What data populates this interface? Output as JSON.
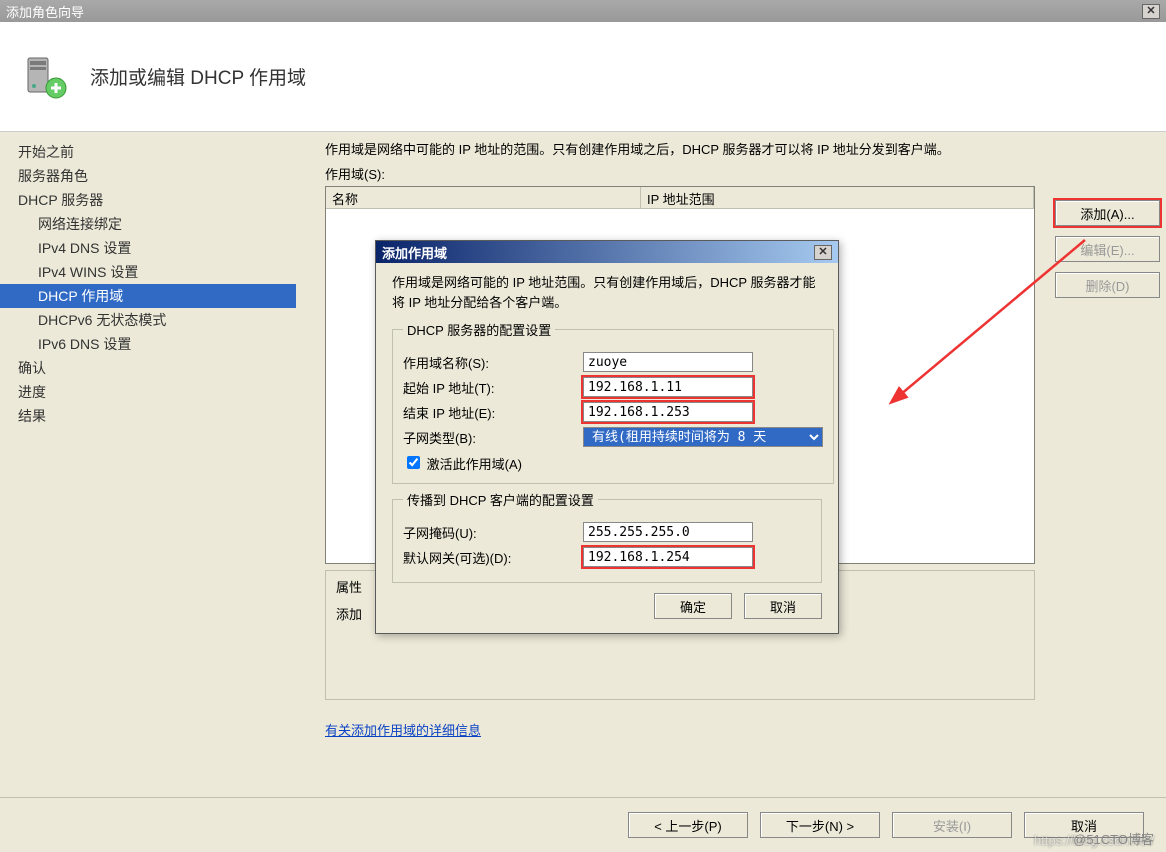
{
  "window": {
    "title": "添加角色向导"
  },
  "header": {
    "page_title": "添加或编辑 DHCP 作用域"
  },
  "sidebar": {
    "items": [
      {
        "label": "开始之前",
        "indent": false,
        "selected": false
      },
      {
        "label": "服务器角色",
        "indent": false,
        "selected": false
      },
      {
        "label": "DHCP 服务器",
        "indent": false,
        "selected": false
      },
      {
        "label": "网络连接绑定",
        "indent": true,
        "selected": false
      },
      {
        "label": "IPv4 DNS 设置",
        "indent": true,
        "selected": false
      },
      {
        "label": "IPv4 WINS 设置",
        "indent": true,
        "selected": false
      },
      {
        "label": "DHCP 作用域",
        "indent": true,
        "selected": true
      },
      {
        "label": "DHCPv6 无状态模式",
        "indent": true,
        "selected": false
      },
      {
        "label": "IPv6 DNS 设置",
        "indent": true,
        "selected": false
      },
      {
        "label": "确认",
        "indent": false,
        "selected": false
      },
      {
        "label": "进度",
        "indent": false,
        "selected": false
      },
      {
        "label": "结果",
        "indent": false,
        "selected": false
      }
    ]
  },
  "content": {
    "description": "作用域是网络中可能的 IP 地址的范围。只有创建作用域之后，DHCP 服务器才可以将 IP 地址分发到客户端。",
    "scopes_label": "作用域(S):",
    "table": {
      "col_name": "名称",
      "col_range": "IP 地址范围"
    },
    "buttons": {
      "add": "添加(A)...",
      "edit": "编辑(E)...",
      "delete": "删除(D)"
    },
    "props_label": "属性",
    "props_add": "添加",
    "help_link": "有关添加作用域的详细信息"
  },
  "modal": {
    "title": "添加作用域",
    "description": "作用域是网络可能的 IP 地址范围。只有创建作用域后，DHCP 服务器才能将 IP 地址分配给各个客户端。",
    "group1_legend": "DHCP 服务器的配置设置",
    "fields": {
      "name_label": "作用域名称(S):",
      "name_value": "zuoye",
      "start_label": "起始 IP 地址(T):",
      "start_value": "192.168.1.11",
      "end_label": "结束 IP 地址(E):",
      "end_value": "192.168.1.253",
      "subnet_type_label": "子网类型(B):",
      "subnet_type_value": "有线(租用持续时间将为 8 天",
      "activate_label": "激活此作用域(A)"
    },
    "group2_legend": "传播到 DHCP 客户端的配置设置",
    "fields2": {
      "mask_label": "子网掩码(U):",
      "mask_value": "255.255.255.0",
      "gateway_label": "默认网关(可选)(D):",
      "gateway_value": "192.168.1.254"
    },
    "ok": "确定",
    "cancel": "取消"
  },
  "footer": {
    "prev": "< 上一步(P)",
    "next": "下一步(N) >",
    "install": "安装(I)",
    "cancel": "取消"
  },
  "watermark": "https://blog.csdn.net/",
  "watermark2": "@51CTO博客"
}
